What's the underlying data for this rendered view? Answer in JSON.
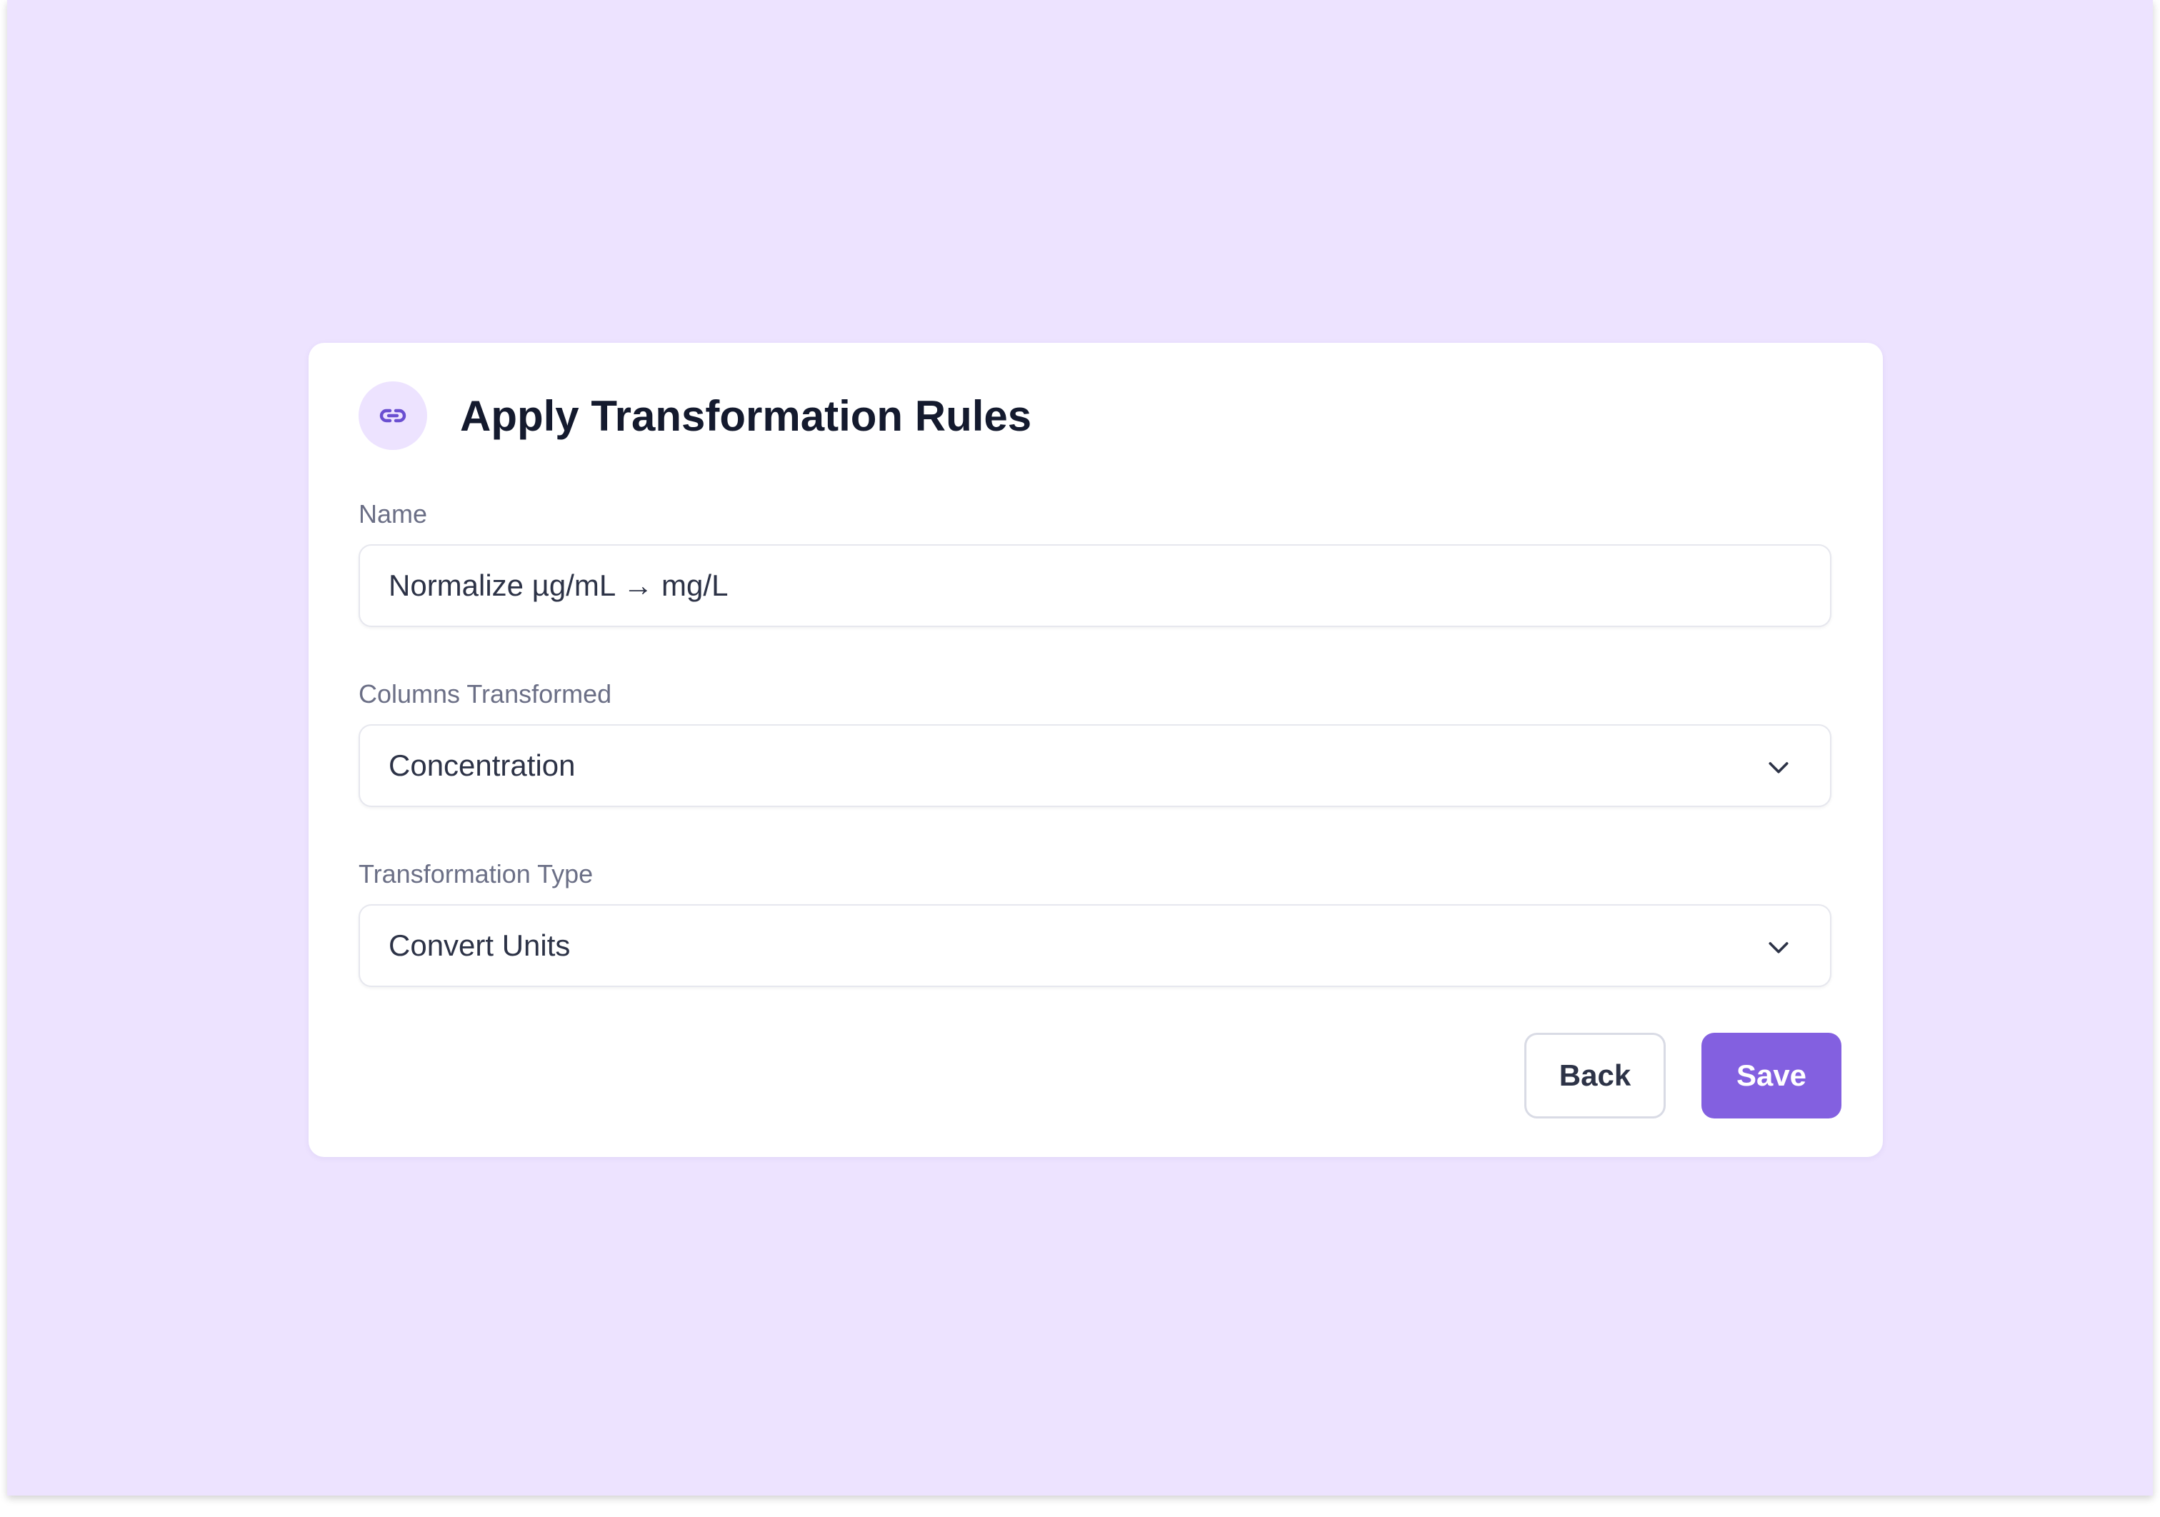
{
  "dialog": {
    "title": "Apply Transformation Rules",
    "icon": "link-icon"
  },
  "form": {
    "name": {
      "label": "Name",
      "value": "Normalize µg/mL → mg/L"
    },
    "columns_transformed": {
      "label": "Columns Transformed",
      "selected": "Concentration"
    },
    "transformation_type": {
      "label": "Transformation Type",
      "selected": "Convert Units"
    }
  },
  "actions": {
    "back_label": "Back",
    "save_label": "Save"
  },
  "colors": {
    "background": "#ede3ff",
    "accent": "#8360e0",
    "icon": "#6a4fd1"
  }
}
